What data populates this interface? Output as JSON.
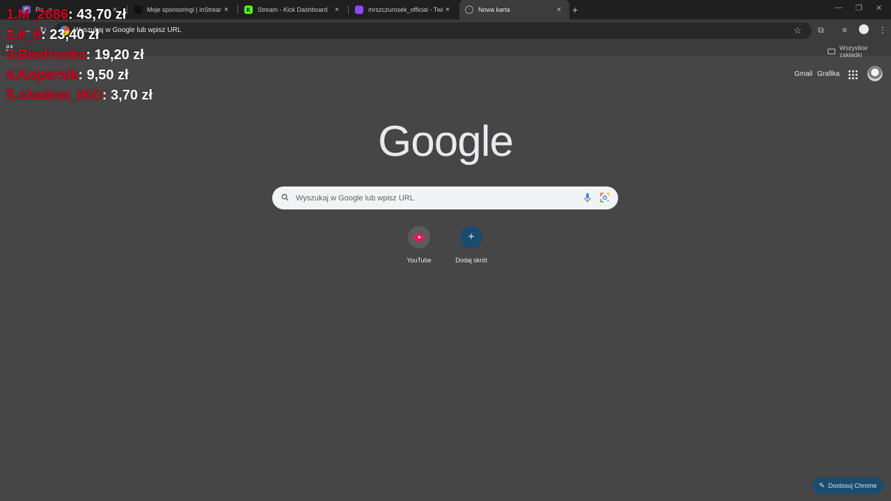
{
  "tabs": [
    {
      "title": "Re...n",
      "favicon_color": "#5b5fc7",
      "favicon_letter": "R",
      "active": false
    },
    {
      "title": "Moje sponsoringi | inStreamly",
      "favicon_color": "#111111",
      "favicon_letter": "",
      "active": false
    },
    {
      "title": "Stream - Kick Dashboard",
      "favicon_color": "#53fc18",
      "favicon_letter": "K",
      "active": false
    },
    {
      "title": "mrszczurosek_official - Twitch",
      "favicon_color": "#9146ff",
      "favicon_letter": "",
      "active": false
    },
    {
      "title": "Nowa karta",
      "favicon_color": "#9aa0a6",
      "favicon_letter": "",
      "active": true
    }
  ],
  "omnibox": {
    "text": "Wyszukaj w Google lub wpisz URL"
  },
  "bookmarks": {
    "all_label": "Wszystkie zakładki"
  },
  "header": {
    "gmail": "Gmail",
    "images": "Grafika"
  },
  "logo": "Google",
  "search": {
    "placeholder": "Wyszukaj w Google lub wpisz URL"
  },
  "shortcuts": [
    {
      "label": "YouTube"
    },
    {
      "label": "Dodaj skrót"
    }
  ],
  "customize_label": "Dostosuj Chrome",
  "donations": [
    {
      "name": "1.M_2686",
      "amount": ": 43,70 zł"
    },
    {
      "name": "2.é_ě",
      "amount": ": 23,40 zł"
    },
    {
      "name": "3.Biedronka",
      "amount": ": 19,20 zł"
    },
    {
      "name": "4.Kopernik",
      "amount": ": 9,50 zł"
    },
    {
      "name": "5.shadow_IKO",
      "amount": ": 3,70 zł"
    }
  ],
  "colors": {
    "donation_name": "#d0021b",
    "donation_amount": "#ffffff",
    "background": "#464646"
  }
}
